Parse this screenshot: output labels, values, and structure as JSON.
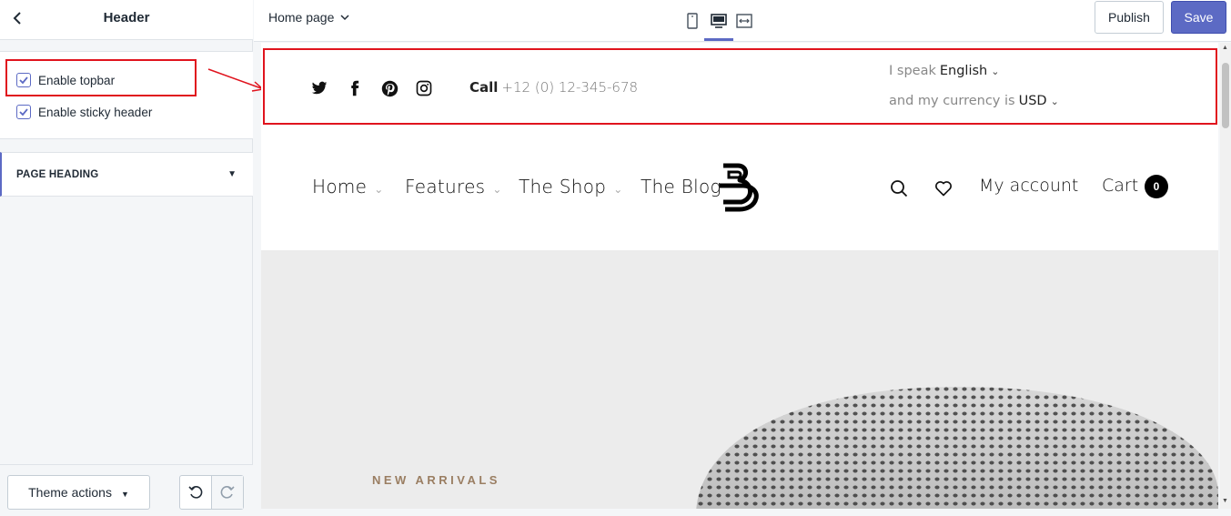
{
  "sidebar": {
    "title": "Header",
    "checkboxes": [
      {
        "label": "Enable topbar",
        "checked": true
      },
      {
        "label": "Enable sticky header",
        "checked": true
      }
    ],
    "section": {
      "label": "PAGE HEADING",
      "caret": "▼"
    },
    "footer": {
      "theme_actions": "Theme actions"
    }
  },
  "topnav": {
    "page_select": "Home page",
    "devices": [
      "mobile-icon",
      "desktop-icon",
      "fullscreen-icon"
    ],
    "active_device": "desktop",
    "publish": "Publish",
    "save": "Save"
  },
  "preview": {
    "topbar": {
      "social": [
        "twitter-icon",
        "facebook-icon",
        "pinterest-icon",
        "instagram-icon"
      ],
      "call_label": "Call",
      "call_number": "+12 (0) 12-345-678",
      "lang_prefix": "I speak",
      "lang_value": "English",
      "curr_prefix": "and my currency is",
      "curr_value": "USD"
    },
    "nav": {
      "items": [
        "Home",
        "Features",
        "The Shop",
        "The Blog"
      ],
      "account": "My account",
      "cart": "Cart",
      "cart_count": "0"
    },
    "hero": {
      "eyebrow": "NEW ARRIVALS"
    }
  },
  "colors": {
    "accent": "#5c6ac4",
    "highlight": "#e0141e",
    "hero_bg": "#ececec",
    "eyebrow": "#9a7e62"
  }
}
